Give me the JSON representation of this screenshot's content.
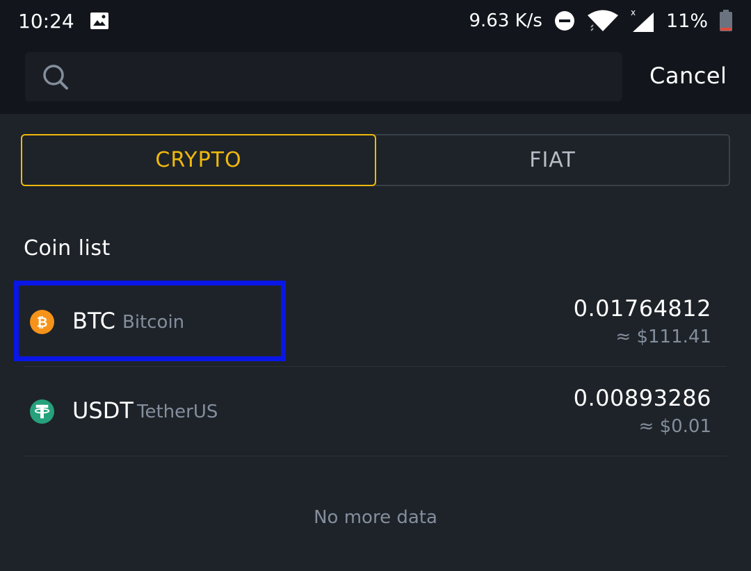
{
  "status_bar": {
    "time": "10:24",
    "network_speed": "9.63 K/s",
    "battery": "11%",
    "icons": [
      "image-icon",
      "dnd-icon",
      "wifi-icon",
      "signal-icon",
      "battery-icon"
    ]
  },
  "search": {
    "placeholder": "",
    "value": "",
    "cancel_label": "Cancel"
  },
  "tabs": [
    {
      "label": "CRYPTO",
      "active": true
    },
    {
      "label": "FIAT",
      "active": false
    }
  ],
  "section": {
    "title": "Coin list"
  },
  "coins": [
    {
      "symbol": "BTC",
      "name": "Bitcoin",
      "amount": "0.01764812",
      "value": "≈ $111.41",
      "icon": "bitcoin-icon",
      "color": "#f7931a",
      "highlighted": true
    },
    {
      "symbol": "USDT",
      "name": "TetherUS",
      "amount": "0.00893286",
      "value": "≈ $0.01",
      "icon": "tether-icon",
      "color": "#26a17b",
      "highlighted": false
    }
  ],
  "footer": {
    "no_more": "No more data"
  },
  "colors": {
    "accent": "#f0b90b",
    "background": "#1e2329",
    "highlight": "#0a16e6"
  }
}
